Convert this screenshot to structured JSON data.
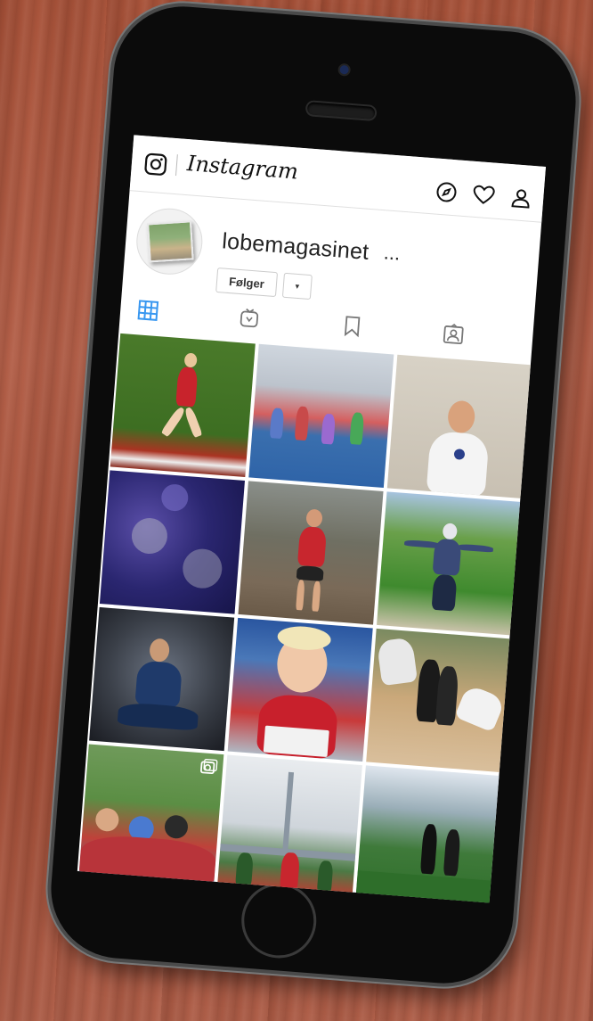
{
  "app": {
    "title": "Instagram",
    "header_icons": [
      "explore-compass-icon",
      "activity-heart-icon",
      "profile-person-icon"
    ]
  },
  "profile": {
    "username": "lobemagasinet",
    "more_label": "...",
    "follow_button": "Følger",
    "dropdown_button": "▾"
  },
  "tabs": [
    "grid-icon",
    "igtv-icon",
    "saved-icon",
    "tagged-icon"
  ],
  "posts": [
    {
      "id": "sprinter-on-grass"
    },
    {
      "id": "track-race"
    },
    {
      "id": "man-arms-crossed"
    },
    {
      "id": "medals-pile"
    },
    {
      "id": "runner-in-red"
    },
    {
      "id": "runner-antlers-field"
    },
    {
      "id": "runner-crouching-dark"
    },
    {
      "id": "smiling-runner-bib"
    },
    {
      "id": "runners-crowd-street"
    },
    {
      "id": "crowd-cheering"
    },
    {
      "id": "bridge-race"
    },
    {
      "id": "runners-park"
    }
  ],
  "colors": {
    "accent": "#3897f0",
    "text": "#262626",
    "border": "#dbdbdb"
  }
}
